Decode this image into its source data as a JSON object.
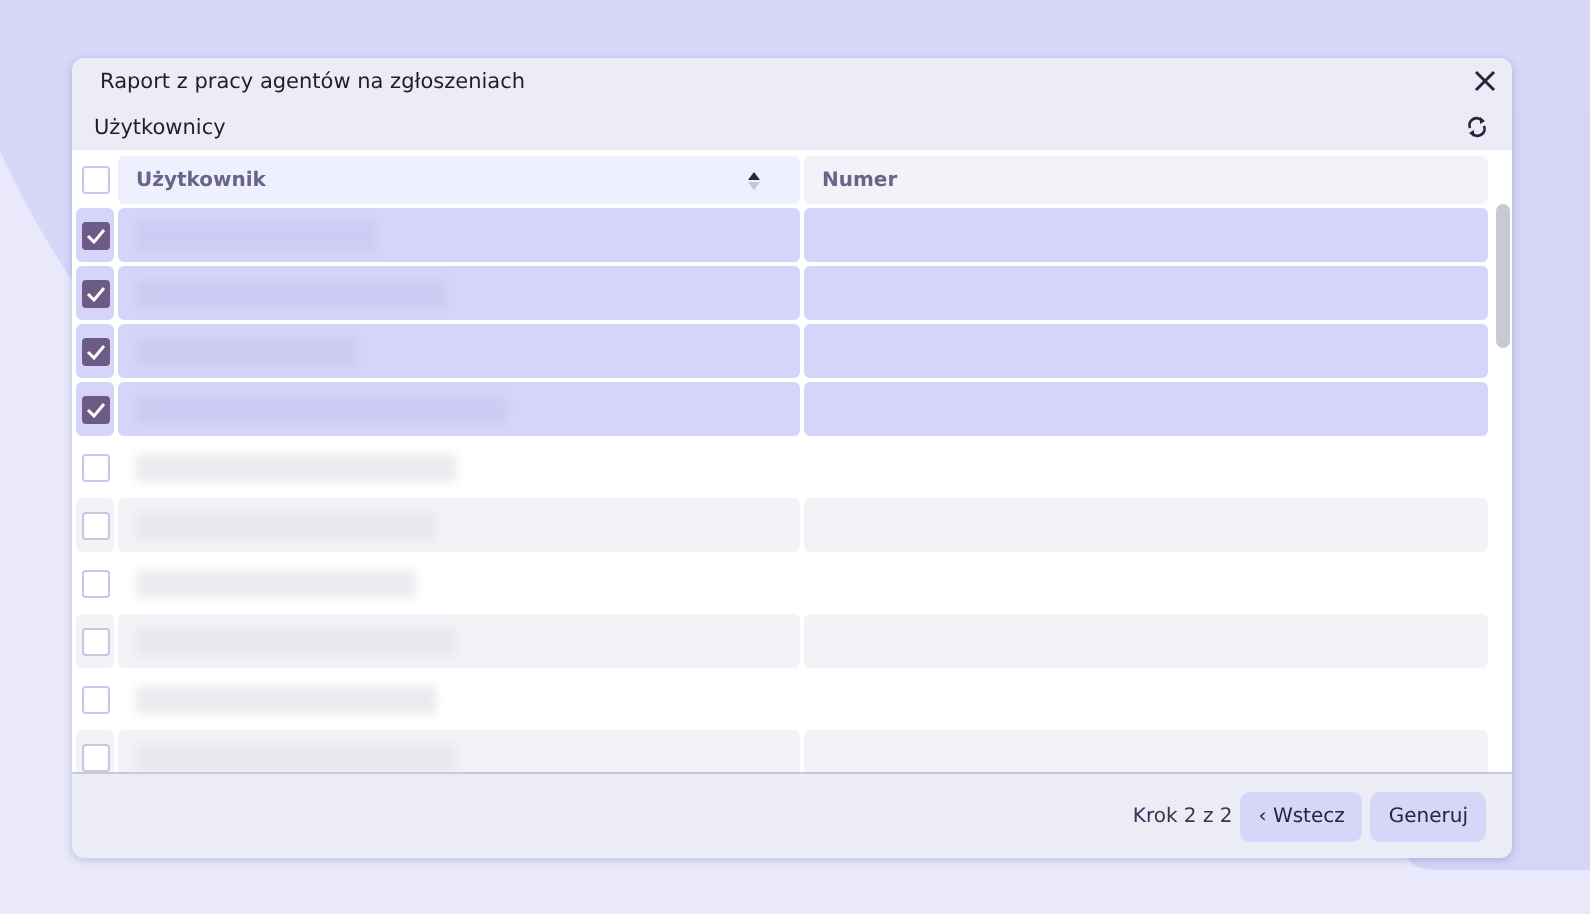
{
  "dialog": {
    "title": "Raport z pracy agentów na zgłoszeniach",
    "section": "Użytkownicy"
  },
  "table": {
    "select_all": {
      "checked": false
    },
    "columns": [
      {
        "label": "Użytkownik",
        "sortable": true
      },
      {
        "label": "Numer",
        "sortable": false
      }
    ],
    "rows": [
      {
        "selected": true
      },
      {
        "selected": true
      },
      {
        "selected": true
      },
      {
        "selected": true
      },
      {
        "selected": false
      },
      {
        "selected": false
      },
      {
        "selected": false
      },
      {
        "selected": false
      },
      {
        "selected": false
      },
      {
        "selected": false
      }
    ]
  },
  "footer": {
    "step": "Krok 2 z 2",
    "back_button": "‹ Wstecz",
    "generate_button": "Generuj"
  }
}
